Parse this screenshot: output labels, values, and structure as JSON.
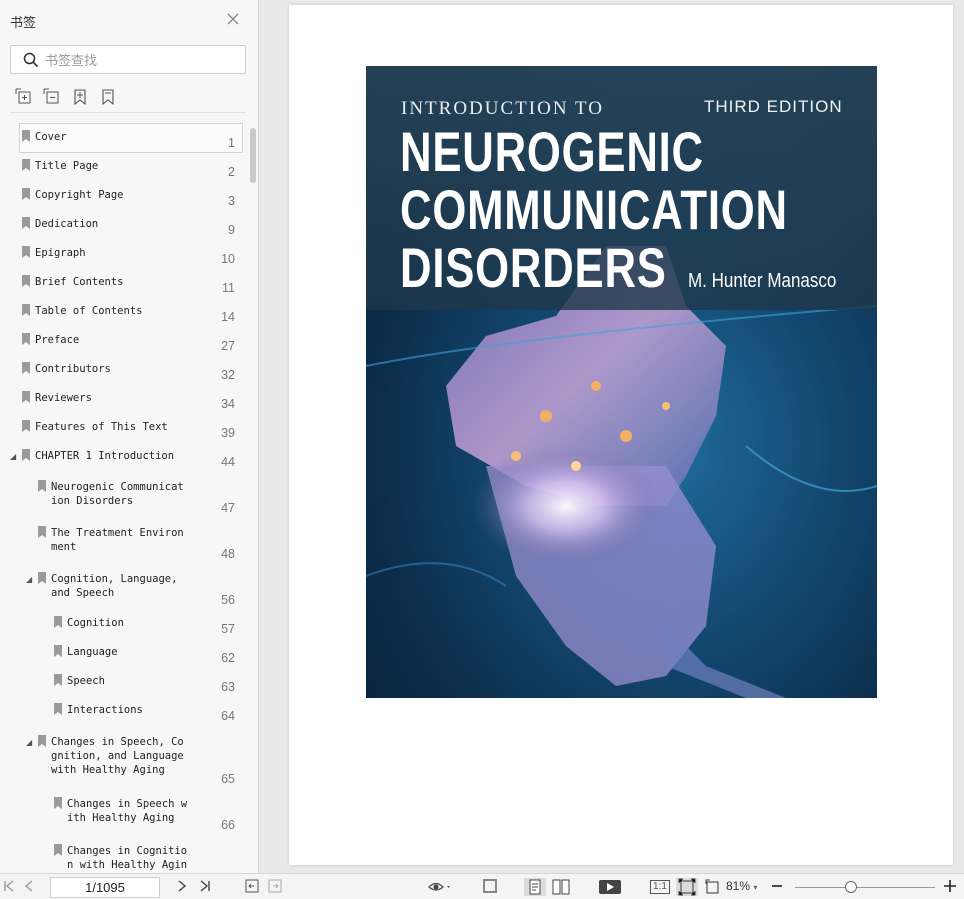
{
  "sidebar": {
    "title": "书签",
    "search_placeholder": "书签查找",
    "bookmarks": [
      {
        "label": "Cover",
        "page": "1"
      },
      {
        "label": "Title Page",
        "page": "2"
      },
      {
        "label": "Copyright Page",
        "page": "3"
      },
      {
        "label": "Dedication",
        "page": "9"
      },
      {
        "label": "Epigraph",
        "page": "10"
      },
      {
        "label": "Brief Contents",
        "page": "11"
      },
      {
        "label": "Table of Contents",
        "page": "14"
      },
      {
        "label": "Preface",
        "page": "27"
      },
      {
        "label": "Contributors",
        "page": "32"
      },
      {
        "label": "Reviewers",
        "page": "34"
      },
      {
        "label": "Features of This Text",
        "page": "39"
      },
      {
        "label": "CHAPTER 1 Introduction",
        "page": "44"
      },
      {
        "label": "Neurogenic Communicat\nion Disorders",
        "page": "47"
      },
      {
        "label": "The Treatment Environ\nment",
        "page": "48"
      },
      {
        "label": "Cognition, Language,\nand Speech",
        "page": "56"
      },
      {
        "label": "Cognition",
        "page": "57"
      },
      {
        "label": "Language",
        "page": "62"
      },
      {
        "label": "Speech",
        "page": "63"
      },
      {
        "label": "Interactions",
        "page": "64"
      },
      {
        "label": "Changes in Speech, Co\ngnition, and Language\nwith Healthy Aging",
        "page": "65"
      },
      {
        "label": "Changes in Speech w\nith Healthy Aging",
        "page": "66"
      },
      {
        "label": "Changes in Cognitio\nn with Healthy Agin",
        "page": ""
      }
    ]
  },
  "cover": {
    "intro": "INTRODUCTION TO",
    "edition": "THIRD EDITION",
    "title_lines": [
      "NEUROGENIC",
      "COMMUNICATION",
      "DISORDERS"
    ],
    "author": "M. Hunter Manasco"
  },
  "toolbar": {
    "page_indicator": "1/1095",
    "zoom": "81%",
    "zoom_level": 0.81,
    "actual_size_label": "1:1"
  },
  "colors": {
    "sidebar_bg": "#f7f7f7",
    "canvas_bg": "#e9e9e9",
    "cover_dark": "#0b2c49",
    "cover_blue": "#1f6b9c"
  }
}
